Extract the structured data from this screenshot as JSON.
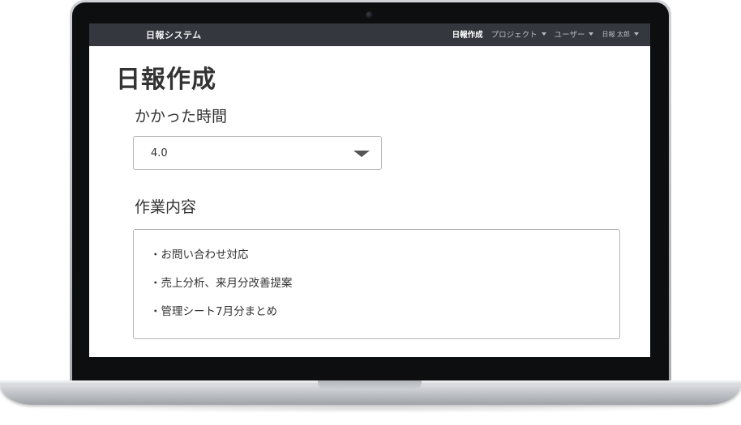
{
  "app": {
    "brand": "日報システム"
  },
  "nav": {
    "items": [
      {
        "label": "日報作成",
        "active": true,
        "dropdown": false
      },
      {
        "label": "プロジェクト",
        "active": false,
        "dropdown": true
      },
      {
        "label": "ユーザー",
        "active": false,
        "dropdown": true
      },
      {
        "label": "日報 太郎",
        "active": false,
        "dropdown": true
      }
    ]
  },
  "page": {
    "title": "日報作成"
  },
  "form": {
    "time_label": "かかった時間",
    "time_value": "4.0",
    "content_label": "作業内容",
    "content_lines": [
      "・お問い合わせ対応",
      "・売上分析、来月分改善提案",
      "・管理シート7月分まとめ"
    ]
  },
  "colors": {
    "navbar_bg": "#34383e",
    "text": "#333333",
    "border": "#b5b5b5"
  }
}
